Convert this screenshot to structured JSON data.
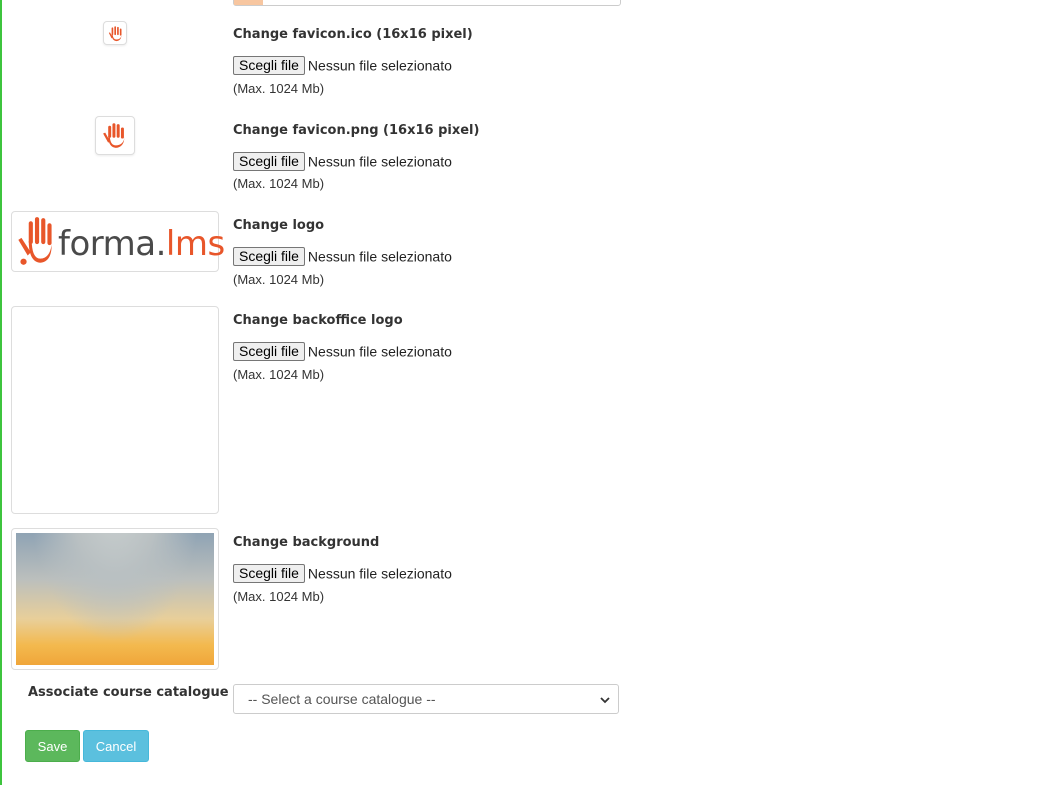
{
  "form": {
    "favicon_ico": {
      "label": "Change favicon.ico (16x16 pixel)",
      "button": "Scegli file",
      "status": "Nessun file selezionato",
      "max": "(Max. 1024 Mb)"
    },
    "favicon_png": {
      "label": "Change favicon.png (16x16 pixel)",
      "button": "Scegli file",
      "status": "Nessun file selezionato",
      "max": "(Max. 1024 Mb)"
    },
    "logo": {
      "label": "Change logo",
      "button": "Scegli file",
      "status": "Nessun file selezionato",
      "max": "(Max. 1024 Mb)",
      "brand_text_main": "forma",
      "brand_text_dot": ".",
      "brand_text_suffix": "lms"
    },
    "backoffice_logo": {
      "label": "Change backoffice logo",
      "button": "Scegli file",
      "status": "Nessun file selezionato",
      "max": "(Max. 1024 Mb)"
    },
    "background": {
      "label": "Change background",
      "button": "Scegli file",
      "status": "Nessun file selezionato",
      "max": "(Max. 1024 Mb)"
    },
    "catalogue": {
      "label": "Associate course catalogue",
      "selected": "-- Select a course catalogue --"
    },
    "actions": {
      "save": "Save",
      "cancel": "Cancel"
    }
  },
  "colors": {
    "brand_orange": "#e8562a",
    "brand_dark": "#4a4a4a",
    "save_green": "#5cb85c",
    "cancel_blue": "#5bc0de"
  }
}
